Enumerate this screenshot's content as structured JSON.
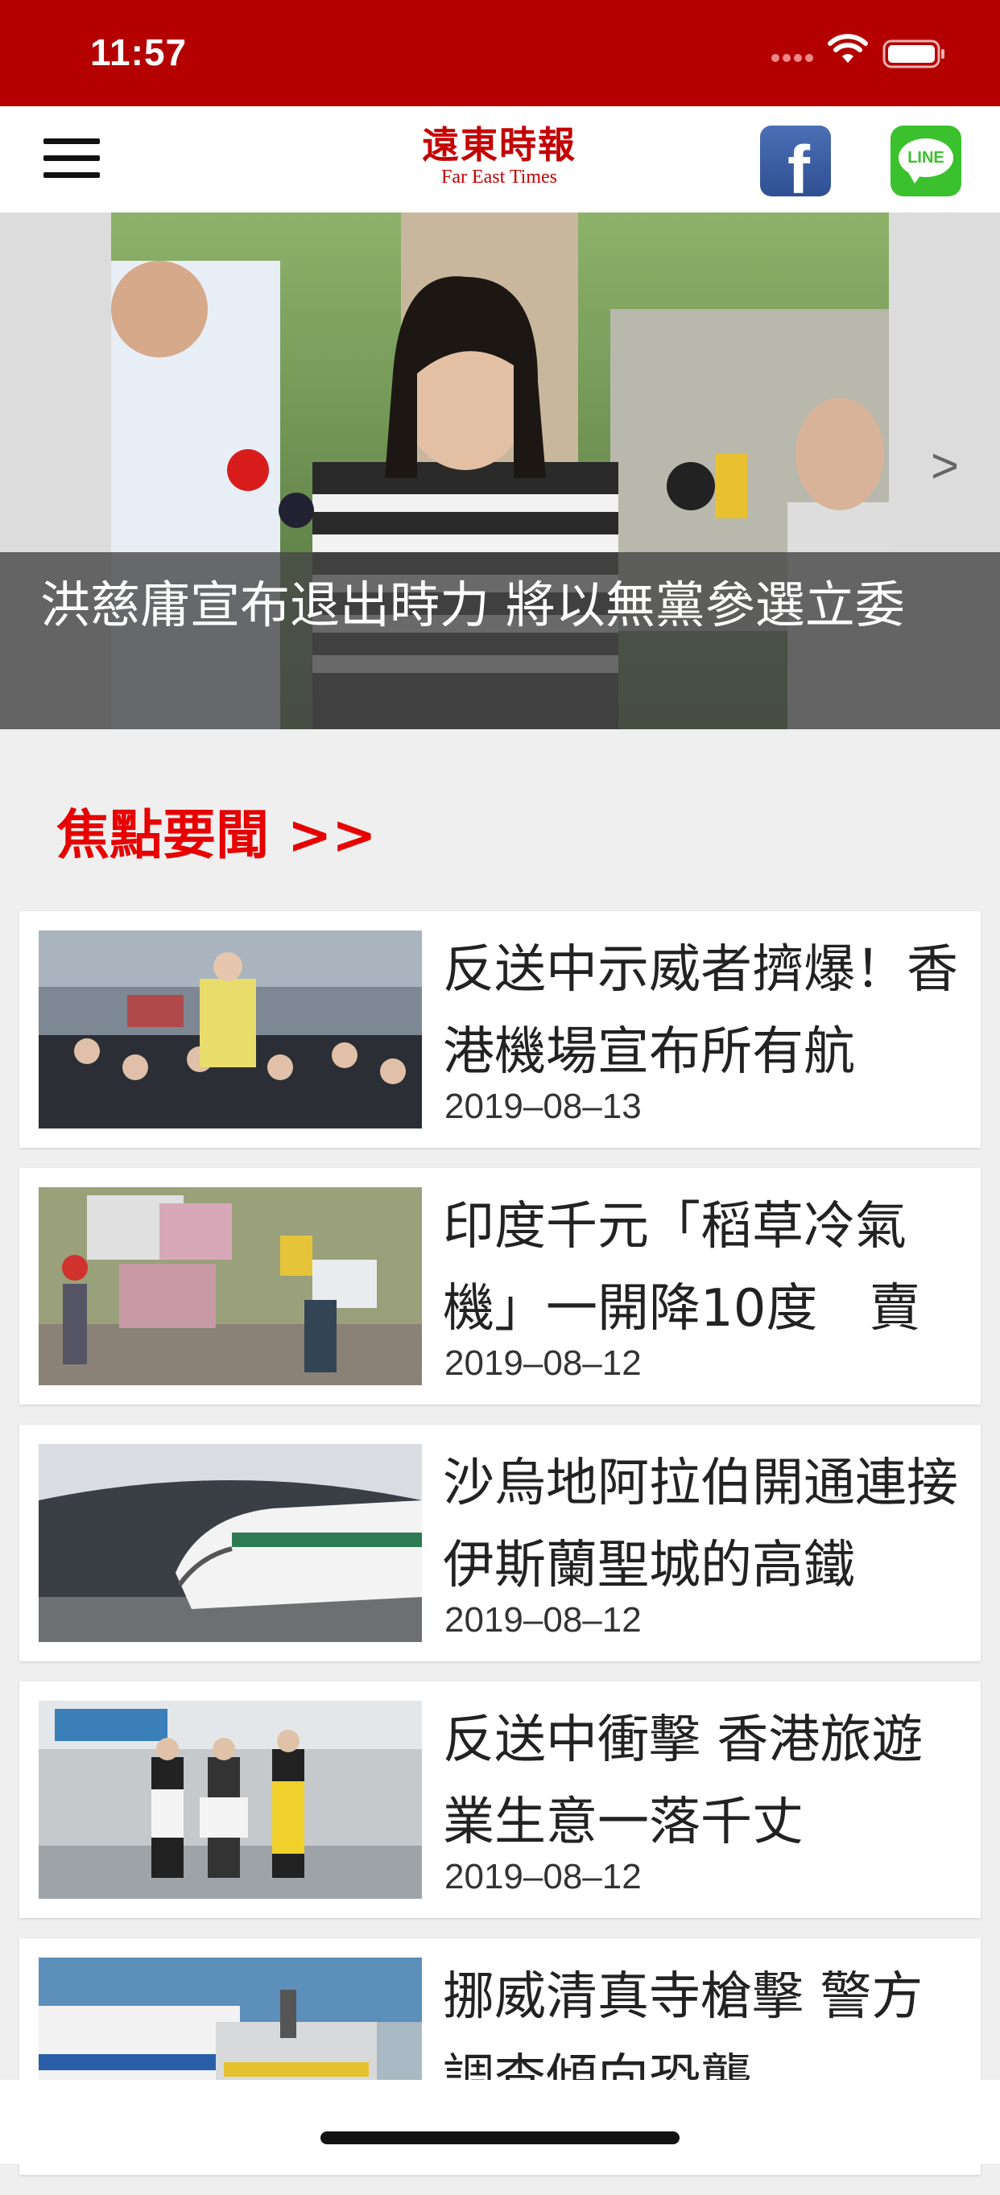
{
  "status_bar": {
    "time": "11:57"
  },
  "header": {
    "logo_cn": "遠東時報",
    "logo_en": "Far East Times",
    "facebook_glyph": "f",
    "line_label": "LINE"
  },
  "hero": {
    "caption": "洪慈庸宣布退出時力 將以無黨參選立委",
    "next_glyph": ">"
  },
  "section": {
    "title": "焦點要聞 >>"
  },
  "news": [
    {
      "title": "反送中示威者擠爆！香港機場宣布所有航",
      "date": "2019–08–13"
    },
    {
      "title": "印度千元「稻草冷氣機」一開降10度　賣",
      "date": "2019–08–12"
    },
    {
      "title": "沙烏地阿拉伯開通連接伊斯蘭聖城的高鐵",
      "date": "2019–08–12"
    },
    {
      "title": "反送中衝擊 香港旅遊業生意一落千丈",
      "date": "2019–08–12"
    },
    {
      "title": "挪威清真寺槍擊 警方調查傾向恐襲",
      "date": ""
    }
  ],
  "colors": {
    "brand_red": "#b50000",
    "section_red": "#e60000",
    "facebook_blue": "#3b5998",
    "line_green": "#3bc12d"
  },
  "icons": [
    "menu-icon",
    "facebook-icon",
    "line-icon",
    "wifi-icon",
    "battery-icon",
    "chevron-right-icon"
  ]
}
